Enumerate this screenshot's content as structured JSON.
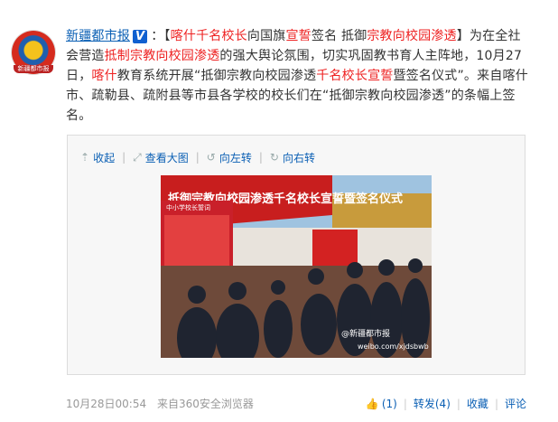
{
  "post": {
    "author": "新疆都市报",
    "verified_badge": "V",
    "colon": "：",
    "text_parts": [
      {
        "t": "【",
        "hl": false
      },
      {
        "t": "喀什千名校长",
        "hl": true
      },
      {
        "t": "向国旗",
        "hl": false
      },
      {
        "t": "宣誓",
        "hl": true
      },
      {
        "t": "签名 抵御",
        "hl": false
      },
      {
        "t": "宗教向校园渗透",
        "hl": true
      },
      {
        "t": "】为在全社会营造",
        "hl": false
      },
      {
        "t": "抵制宗教向校园渗透",
        "hl": true
      },
      {
        "t": "的强大舆论氛围，切实巩固教书育人主阵地，10月27日，",
        "hl": false
      },
      {
        "t": "喀什",
        "hl": true
      },
      {
        "t": "教育系统开展“抵御宗教向校园渗透",
        "hl": false
      },
      {
        "t": "千名校长宣誓",
        "hl": true
      },
      {
        "t": "暨签名仪式”。来自喀什市、疏勒县、疏附县等市县各学校的校长们在“抵御宗教向校园渗透”的条幅上签名。",
        "hl": false
      }
    ]
  },
  "media": {
    "toolbar": [
      {
        "label": "收起",
        "icon": "arrow-up-icon"
      },
      {
        "label": "查看大图",
        "icon": "expand-icon"
      },
      {
        "label": "向左转",
        "icon": "rotate-left-icon"
      },
      {
        "label": "向右转",
        "icon": "rotate-right-icon"
      }
    ],
    "banner_text": "抵御宗教向校园渗透千名校长宣誓暨签名仪式",
    "board_title": "中小学校长誓词",
    "watermark": "@新疆都市报",
    "watermark_url": "weibo.com/xjdsbwb"
  },
  "footer": {
    "time": "10月28日00:54",
    "from_label": "来自",
    "source": "360安全浏览器",
    "like_count": "(1)",
    "repost": "转发(4)",
    "favorite": "收藏",
    "comment": "评论"
  },
  "colors": {
    "link": "#0a5fb4",
    "highlight": "#e22222",
    "text": "#333333",
    "muted": "#999999"
  }
}
